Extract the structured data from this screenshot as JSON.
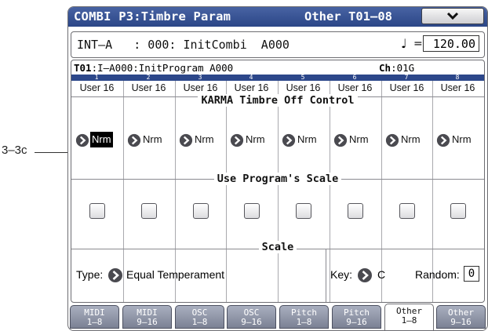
{
  "callout": {
    "label": "3–3c"
  },
  "title": {
    "left": "COMBI  P3:Timbre Param",
    "right": "Other T01–08"
  },
  "menu": {
    "icon": "chevron-down-icon"
  },
  "combi": {
    "name": "INT–A   : 000: InitCombi  A000",
    "tempo_symbol": "♩",
    "tempo_eq": "=",
    "tempo": "120.00"
  },
  "program": {
    "timbre": "T01",
    "name": ":I–A000:InitProgram A000",
    "ch_label": "Ch",
    "ch_value": ":01G"
  },
  "timbres": [
    {
      "num": "1",
      "bank": "User 16",
      "karma": "Nrm",
      "scale": false
    },
    {
      "num": "2",
      "bank": "User 16",
      "karma": "Nrm",
      "scale": false
    },
    {
      "num": "3",
      "bank": "User 16",
      "karma": "Nrm",
      "scale": false
    },
    {
      "num": "4",
      "bank": "User 16",
      "karma": "Nrm",
      "scale": false
    },
    {
      "num": "5",
      "bank": "User 16",
      "karma": "Nrm",
      "scale": false
    },
    {
      "num": "6",
      "bank": "User 16",
      "karma": "Nrm",
      "scale": false
    },
    {
      "num": "7",
      "bank": "User 16",
      "karma": "Nrm",
      "scale": false
    },
    {
      "num": "8",
      "bank": "User 16",
      "karma": "Nrm",
      "scale": false
    }
  ],
  "sections": {
    "karma": "KARMA Timbre Off Control",
    "use_scale": "Use Program's Scale",
    "scale": "Scale"
  },
  "scale": {
    "type_label": "Type:",
    "type_value": "Equal Temperament",
    "key_label": "Key:",
    "key_value": "C",
    "random_label": "Random:",
    "random_value": "0"
  },
  "tabs": [
    {
      "line1": "MIDI",
      "line2": "1–8",
      "active": false
    },
    {
      "line1": "MIDI",
      "line2": "9–16",
      "active": false
    },
    {
      "line1": "OSC",
      "line2": "1–8",
      "active": false
    },
    {
      "line1": "OSC",
      "line2": "9–16",
      "active": false
    },
    {
      "line1": "Pitch",
      "line2": "1–8",
      "active": false
    },
    {
      "line1": "Pitch",
      "line2": "9–16",
      "active": false
    },
    {
      "line1": "Other",
      "line2": "1–8",
      "active": true
    },
    {
      "line1": "Other",
      "line2": "9–16",
      "active": false
    }
  ],
  "colors": {
    "title_bar": "#2b4687",
    "selection": "#000000",
    "tab_inactive": "#7b8194"
  }
}
